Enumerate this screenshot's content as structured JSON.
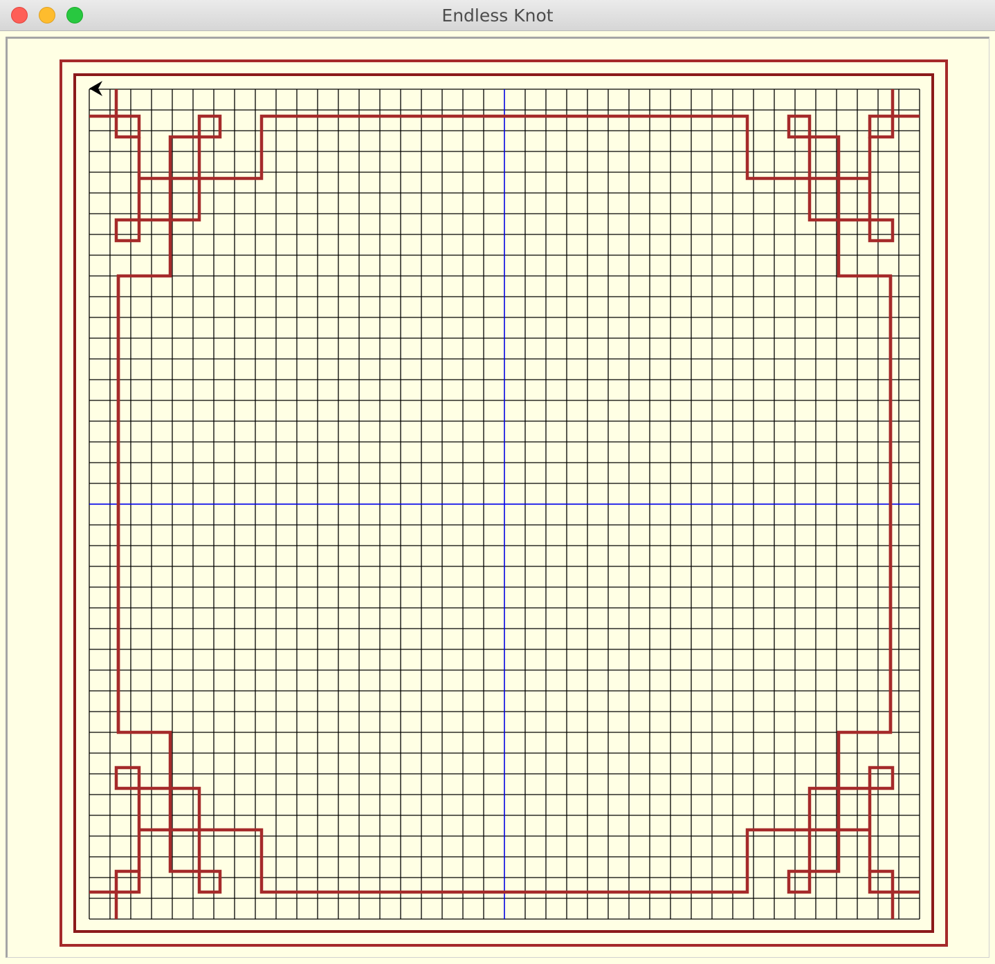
{
  "window": {
    "title": "Endless Knot"
  },
  "canvas": {
    "background": "#ffffe4",
    "grid_color": "#000000",
    "axis_color": "#0000ff",
    "knot_color": "#a52a2a",
    "frame_color": "#a52a2a",
    "turtle_color": "#000000",
    "grid_cells": 40,
    "turtle": "arrow-cursor"
  }
}
